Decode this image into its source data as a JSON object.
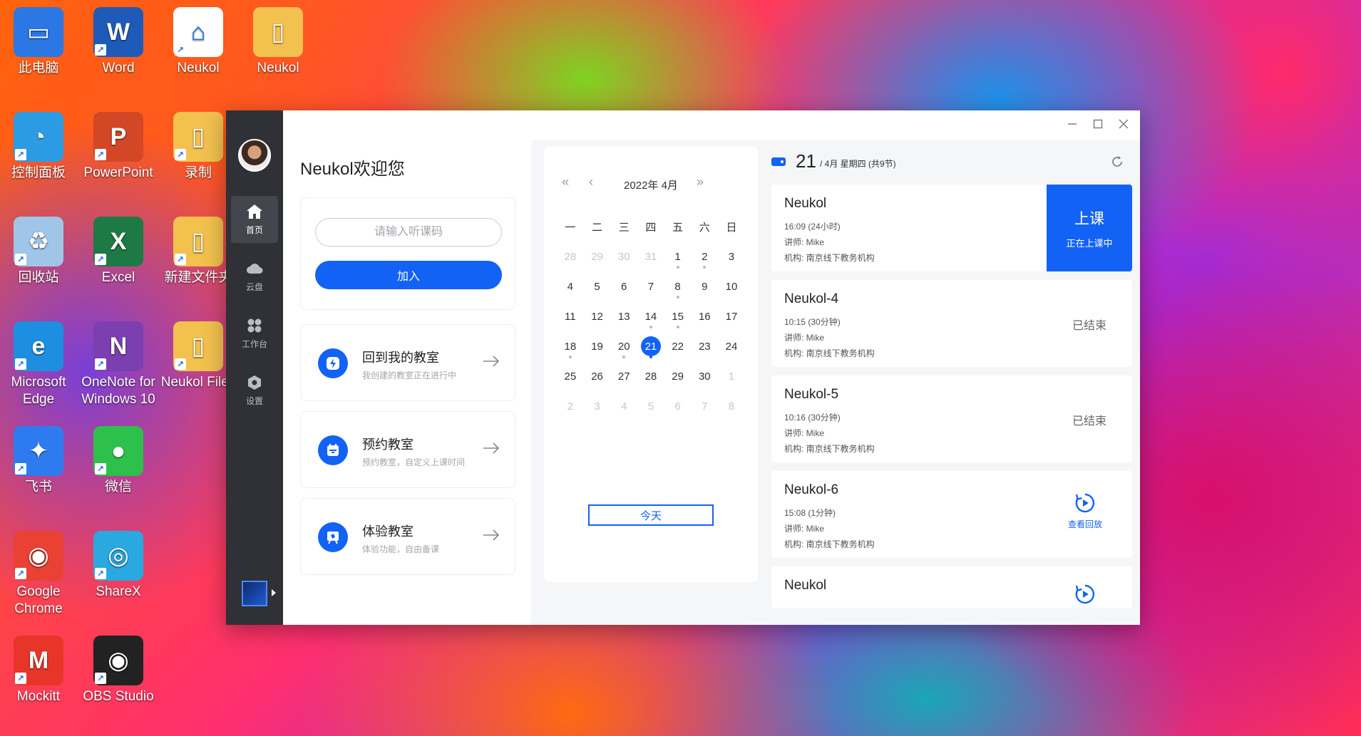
{
  "desktop": {
    "icons": [
      {
        "label": "此电脑",
        "color": "#2b78e4"
      },
      {
        "label": "Word",
        "color": "#1e5bb8"
      },
      {
        "label": "Neukol",
        "color": "#ffffff"
      },
      {
        "label": "Neukol",
        "color": "#f2c14e"
      },
      {
        "label": "控制面板",
        "color": "#2b9be4"
      },
      {
        "label": "PowerPoint",
        "color": "#d24726"
      },
      {
        "label": "录制",
        "color": "#f2c14e"
      },
      {
        "label": "回收站",
        "color": "#9fc6e8"
      },
      {
        "label": "Excel",
        "color": "#1e7a45"
      },
      {
        "label": "新建文件夹",
        "color": "#f2c14e"
      },
      {
        "label": "Microsoft Edge",
        "color": "#1d8ee0"
      },
      {
        "label": "OneNote for Windows 10",
        "color": "#7b3fb0"
      },
      {
        "label": "Neukol Files",
        "color": "#f2c14e"
      },
      {
        "label": "飞书",
        "color": "#2e7bf0"
      },
      {
        "label": "微信",
        "color": "#2dc04a"
      },
      {
        "label": "Google Chrome",
        "color": "#e94235"
      },
      {
        "label": "ShareX",
        "color": "#2aa8e0"
      },
      {
        "label": "Mockitt",
        "color": "#e8352a"
      },
      {
        "label": "OBS Studio",
        "color": "#222222"
      }
    ]
  },
  "app": {
    "accent": "#1262f5",
    "sidebar": {
      "items": [
        {
          "label": "首页",
          "icon": "home-icon"
        },
        {
          "label": "云盘",
          "icon": "cloud-icon"
        },
        {
          "label": "工作台",
          "icon": "workbench-icon"
        },
        {
          "label": "设置",
          "icon": "settings-icon"
        }
      ]
    },
    "left": {
      "welcome": "Neukol欢迎您",
      "join": {
        "placeholder": "请输入听课码",
        "button": "加入"
      },
      "actions": [
        {
          "title": "回到我的教室",
          "subtitle": "我创建的教室正在进行中",
          "icon": "lightning-icon"
        },
        {
          "title": "预约教室",
          "subtitle": "预约教室，自定义上课时间",
          "icon": "calendar-icon"
        },
        {
          "title": "体验教室",
          "subtitle": "体验功能，自由备课",
          "icon": "board-icon"
        }
      ]
    },
    "calendar": {
      "prev_year": "«",
      "prev_month": "‹",
      "title": "2022年 4月",
      "next_month": "›",
      "next_year": "»",
      "weekdays": [
        "一",
        "二",
        "三",
        "四",
        "五",
        "六",
        "日"
      ],
      "weeks": [
        [
          {
            "d": "28",
            "m": 1
          },
          {
            "d": "29",
            "m": 1
          },
          {
            "d": "30",
            "m": 1
          },
          {
            "d": "31",
            "m": 1
          },
          {
            "d": "1",
            "dot": 1
          },
          {
            "d": "2",
            "dot": 1
          },
          {
            "d": "3"
          }
        ],
        [
          {
            "d": "4"
          },
          {
            "d": "5"
          },
          {
            "d": "6"
          },
          {
            "d": "7"
          },
          {
            "d": "8",
            "dot": 1
          },
          {
            "d": "9"
          },
          {
            "d": "10"
          }
        ],
        [
          {
            "d": "11"
          },
          {
            "d": "12"
          },
          {
            "d": "13"
          },
          {
            "d": "14",
            "dot": 1
          },
          {
            "d": "15",
            "dot": 1
          },
          {
            "d": "16"
          },
          {
            "d": "17"
          }
        ],
        [
          {
            "d": "18",
            "dot": 1
          },
          {
            "d": "19"
          },
          {
            "d": "20",
            "dot": 1
          },
          {
            "d": "21",
            "sel": 1,
            "dot": 1
          },
          {
            "d": "22"
          },
          {
            "d": "23"
          },
          {
            "d": "24"
          }
        ],
        [
          {
            "d": "25"
          },
          {
            "d": "26"
          },
          {
            "d": "27"
          },
          {
            "d": "28"
          },
          {
            "d": "29"
          },
          {
            "d": "30"
          },
          {
            "d": "1",
            "m": 1
          }
        ],
        [
          {
            "d": "2",
            "m": 1
          },
          {
            "d": "3",
            "m": 1
          },
          {
            "d": "4",
            "m": 1
          },
          {
            "d": "5",
            "m": 1
          },
          {
            "d": "6",
            "m": 1
          },
          {
            "d": "7",
            "m": 1
          },
          {
            "d": "8",
            "m": 1
          }
        ]
      ],
      "today_button": "今天"
    },
    "schedule": {
      "day": "21",
      "meta": "/ 4月   星期四 (共9节)",
      "lessons": [
        {
          "title": "Neukol",
          "time": "16:09   (24小时)",
          "teacher": "讲师: Mike",
          "org": "机构: 南京线下教务机构",
          "kind": "live",
          "live_big": "上课",
          "live_small": "正在上课中"
        },
        {
          "title": "Neukol-4",
          "time": "10:15   (30分钟)",
          "teacher": "讲师: Mike",
          "org": "机构: 南京线下教务机构",
          "kind": "ended",
          "status": "已结束"
        },
        {
          "title": "Neukol-5",
          "time": "10:16   (30分钟)",
          "teacher": "讲师: Mike",
          "org": "机构: 南京线下教务机构",
          "kind": "ended",
          "status": "已结束"
        },
        {
          "title": "Neukol-6",
          "time": "15:08   (1分钟)",
          "teacher": "讲师: Mike",
          "org": "机构: 南京线下教务机构",
          "kind": "replay",
          "status": "查看回放"
        },
        {
          "title": "Neukol",
          "time": "",
          "teacher": "",
          "org": "",
          "kind": "replay",
          "status": ""
        }
      ]
    }
  }
}
